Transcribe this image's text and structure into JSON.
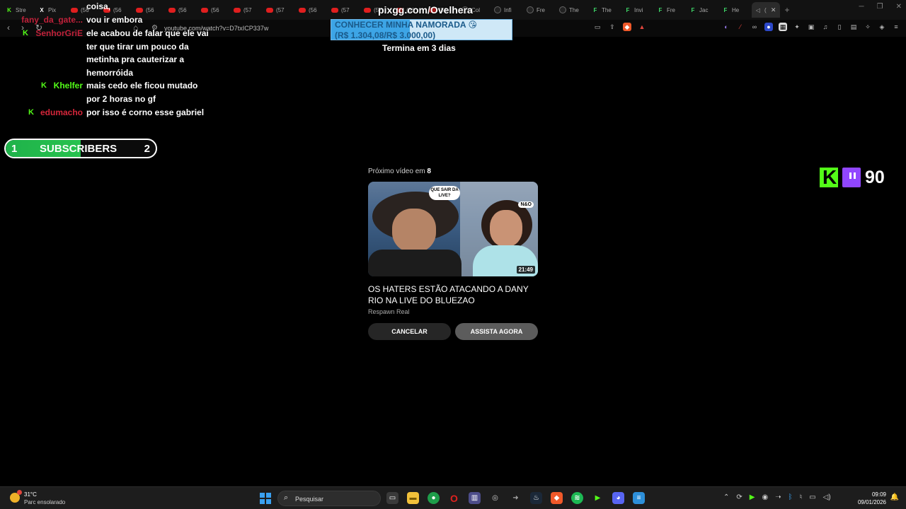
{
  "browser": {
    "tabs": [
      {
        "label": "Stre",
        "icon": "kick"
      },
      {
        "label": "Pix",
        "icon": "x"
      },
      {
        "label": "(56",
        "icon": "youtube"
      },
      {
        "label": "(56",
        "icon": "youtube"
      },
      {
        "label": "(56",
        "icon": "youtube"
      },
      {
        "label": "(56",
        "icon": "youtube"
      },
      {
        "label": "(56",
        "icon": "youtube"
      },
      {
        "label": "(57",
        "icon": "youtube"
      },
      {
        "label": "(57",
        "icon": "youtube"
      },
      {
        "label": "(56",
        "icon": "youtube"
      },
      {
        "label": "(57",
        "icon": "youtube"
      },
      {
        "label": "(57",
        "icon": "youtube"
      },
      {
        "label": "(56",
        "icon": "youtube"
      },
      {
        "label": "(56",
        "icon": "youtube"
      },
      {
        "label": "Col",
        "icon": "github"
      },
      {
        "label": "Infi",
        "icon": "github"
      },
      {
        "label": "Fre",
        "icon": "github"
      },
      {
        "label": "The",
        "icon": "github"
      },
      {
        "label": "The",
        "icon": "fr"
      },
      {
        "label": "Invi",
        "icon": "fr"
      },
      {
        "label": "Fre",
        "icon": "fr"
      },
      {
        "label": "Jac",
        "icon": "fr"
      },
      {
        "label": "He",
        "icon": "fr"
      },
      {
        "label": "(",
        "icon": "audio",
        "active": true
      }
    ],
    "url": "youtube.com/watch?v=D7txICP337w"
  },
  "chat": {
    "partial_line": "coisa,",
    "messages": [
      {
        "user": "fany_da_gate...",
        "user_color": "#c0213a",
        "text": "vou ir embora",
        "badge": false
      },
      {
        "user": "SenhorGriE",
        "user_color": "#c0213a",
        "text": "ele acabou de falar que ele vai ter que tirar um pouco da metinha pra cauterizar a hemorróida",
        "badge": true
      },
      {
        "user": "Khelfer",
        "user_color": "#53fc18",
        "text": "mais cedo ele ficou mutado por 2 horas no gf",
        "badge": true
      },
      {
        "user": "edumacho",
        "user_color": "#d5263a",
        "text": "por isso é corno esse gabriel",
        "badge": true
      }
    ]
  },
  "subscribers": {
    "current": "1",
    "label": "SUBSCRIBERS",
    "goal": "2",
    "progress": 0.5
  },
  "donation_goal": {
    "pix_title": "pixgg.com/Ovelhera",
    "title": "CONHECER MINHA NAMORADA 😘",
    "amount": "(R$ 1.304,08/R$ 3.000,00)",
    "progress": 0.4347,
    "ends": "Termina em 3 dias"
  },
  "counter": {
    "value": "90"
  },
  "up_next": {
    "label": "Próximo vídeo em",
    "countdown": "8",
    "thumbnail": {
      "bubble": "QUE SAIR DA LIVE?",
      "tag": "N&O",
      "duration": "21:49"
    },
    "title": "OS HATERS ESTÃO ATACANDO A DANY RIO NA LIVE DO BLUEZAO",
    "channel": "Respawn Real",
    "cancel_label": "CANCELAR",
    "watch_label": "ASSISTA AGORA"
  },
  "taskbar": {
    "temperature": "31°C",
    "weather": "Parc ensolarado",
    "search_placeholder": "Pesquisar",
    "time": "09:09",
    "date": "09/01/2026"
  },
  "colors": {
    "kick_green": "#53fc18",
    "twitch_purple": "#9146ff",
    "goal_blue": "#3da5e6"
  }
}
